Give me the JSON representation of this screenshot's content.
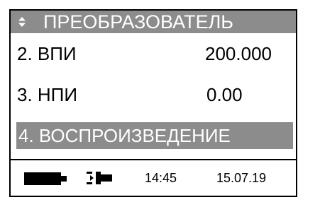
{
  "title_bar": {
    "arrows_icon": "up-down-arrows-icon",
    "title": "ПРЕОБРАЗОВАТЕЛЬ"
  },
  "menu": {
    "items": [
      {
        "label": "2. ВПИ",
        "value": "200.000"
      },
      {
        "label": "3. НПИ",
        "value": "0.00"
      },
      {
        "label": "4. ВОСПРОИЗВЕДЕНИЕ",
        "value": ""
      }
    ],
    "selected_index": 2
  },
  "status_bar": {
    "battery_icon": "battery-icon",
    "power_icon": "power-plug-icon",
    "time": "14:45",
    "date": "15.07.19"
  },
  "colors": {
    "highlight": "#8c8c8c",
    "text": "#000000",
    "highlight_text": "#ffffff",
    "background": "#ffffff"
  }
}
